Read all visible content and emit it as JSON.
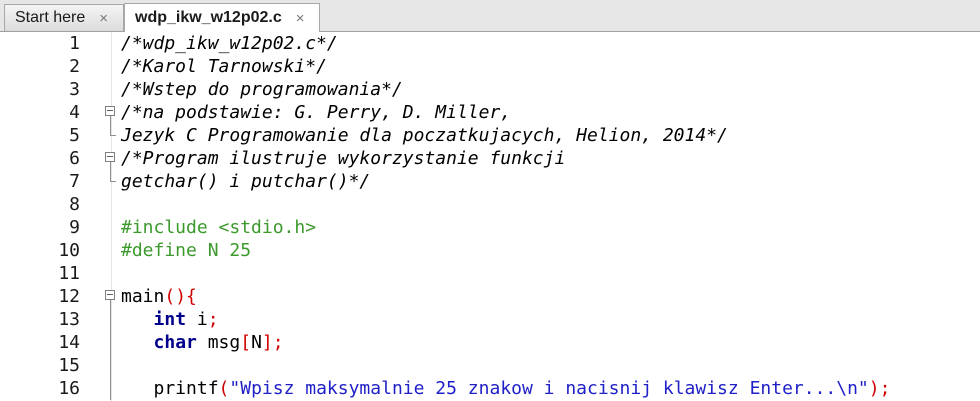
{
  "tabs": [
    {
      "label": "Start here",
      "close": "×",
      "active": false
    },
    {
      "label": "wdp_ikw_w12p02.c",
      "close": "×",
      "active": true
    }
  ],
  "lines": [
    {
      "num": "1",
      "tokens": [
        [
          "/*wdp_ikw_w12p02.c*/",
          "comment"
        ]
      ]
    },
    {
      "num": "2",
      "tokens": [
        [
          "/*Karol Tarnowski*/",
          "comment"
        ]
      ]
    },
    {
      "num": "3",
      "tokens": [
        [
          "/*Wstep do programowania*/",
          "comment"
        ]
      ]
    },
    {
      "num": "4",
      "fold": "start",
      "tokens": [
        [
          "/*na podstawie: G. Perry, D. Miller,",
          "comment"
        ]
      ]
    },
    {
      "num": "5",
      "fold": "end",
      "tokens": [
        [
          "Jezyk C Programowanie dla poczatkujacych, Helion, 2014*/",
          "comment"
        ]
      ]
    },
    {
      "num": "6",
      "fold": "start",
      "tokens": [
        [
          "/*Program ilustruje wykorzystanie funkcji",
          "comment"
        ]
      ]
    },
    {
      "num": "7",
      "fold": "end",
      "tokens": [
        [
          "getchar() i putchar()*/",
          "comment"
        ]
      ]
    },
    {
      "num": "8",
      "tokens": []
    },
    {
      "num": "9",
      "tokens": [
        [
          "#include <stdio.h>",
          "pre"
        ]
      ]
    },
    {
      "num": "10",
      "tokens": [
        [
          "#define N 25",
          "pre"
        ]
      ]
    },
    {
      "num": "11",
      "tokens": []
    },
    {
      "num": "12",
      "fold": "start",
      "tokens": [
        [
          "main",
          "plain"
        ],
        [
          "(){",
          "op"
        ]
      ]
    },
    {
      "num": "13",
      "fold": "mid",
      "tokens": [
        [
          "   ",
          "plain"
        ],
        [
          "int",
          "kw"
        ],
        [
          " i",
          "plain"
        ],
        [
          ";",
          "op"
        ]
      ]
    },
    {
      "num": "14",
      "fold": "mid",
      "tokens": [
        [
          "   ",
          "plain"
        ],
        [
          "char",
          "kw"
        ],
        [
          " msg",
          "plain"
        ],
        [
          "[",
          "op"
        ],
        [
          "N",
          "plain"
        ],
        [
          "];",
          "op"
        ]
      ]
    },
    {
      "num": "15",
      "fold": "mid",
      "tokens": []
    },
    {
      "num": "16",
      "fold": "mid",
      "tokens": [
        [
          "   printf",
          "plain"
        ],
        [
          "(",
          "op"
        ],
        [
          "\"Wpisz maksymalnie 25 znakow i nacisnij klawisz Enter...\\n\"",
          "str"
        ],
        [
          ");",
          "op"
        ]
      ]
    }
  ]
}
